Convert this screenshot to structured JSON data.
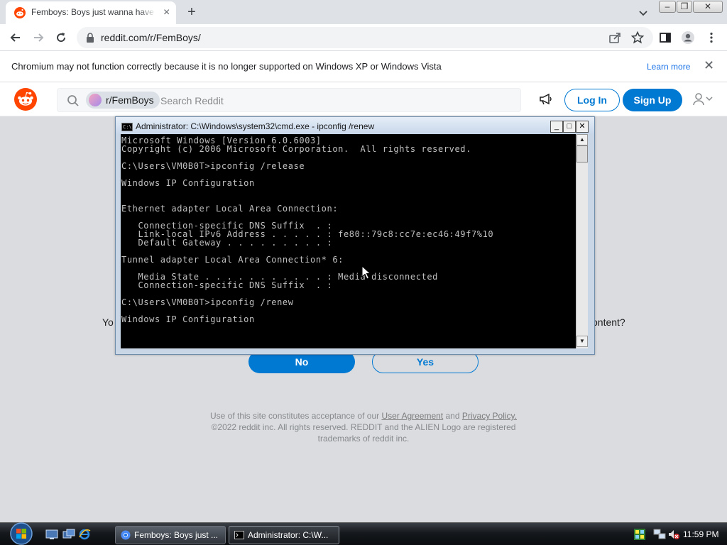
{
  "browser": {
    "tab_title": "Femboys: Boys just wanna have fun",
    "tab_close": "×",
    "new_tab": "+",
    "url": "reddit.com/r/FemBoys/",
    "window_buttons": {
      "minimize": "–",
      "restore": "❐",
      "close": "✕"
    }
  },
  "infobar": {
    "message": "Chromium may not function correctly because it is no longer supported on Windows XP or Windows Vista",
    "learn_more": "Learn more",
    "close": "✕"
  },
  "reddit": {
    "community_chip": "r/FemBoys",
    "search_placeholder": "Search Reddit",
    "login": "Log In",
    "signup": "Sign Up",
    "prompt_left": "Yo",
    "prompt_right": "ontent?",
    "no": "No",
    "yes": "Yes",
    "footer_pre": "Use of this site constitutes acceptance of our ",
    "footer_link1": "User Agreement",
    "footer_mid": " and ",
    "footer_link2": "Privacy Policy.",
    "footer_line2": "©2022 reddit inc. All rights reserved. REDDIT and the ALIEN Logo are registered",
    "footer_line3": "trademarks of reddit inc."
  },
  "cmd": {
    "title": "Administrator: C:\\Windows\\system32\\cmd.exe - ipconfig  /renew",
    "icon_label": "C:\\",
    "buttons": {
      "minimize": "_",
      "maximize": "□",
      "close": "✕"
    },
    "output": "Microsoft Windows [Version 6.0.6003]\nCopyright (c) 2006 Microsoft Corporation.  All rights reserved.\n\nC:\\Users\\VM0B0T>ipconfig /release\n\nWindows IP Configuration\n\n\nEthernet adapter Local Area Connection:\n\n   Connection-specific DNS Suffix  . :\n   Link-local IPv6 Address . . . . . : fe80::79c8:cc7e:ec46:49f7%10\n   Default Gateway . . . . . . . . . :\n\nTunnel adapter Local Area Connection* 6:\n\n   Media State . . . . . . . . . . . : Media disconnected\n   Connection-specific DNS Suffix  . :\n\nC:\\Users\\VM0B0T>ipconfig /renew\n\nWindows IP Configuration"
  },
  "taskbar": {
    "buttons": [
      {
        "label": "Femboys: Boys just ..."
      },
      {
        "label": "Administrator: C:\\W..."
      }
    ],
    "clock": "11:59 PM"
  },
  "colors": {
    "reddit_blue": "#0079d3",
    "reddit_orange": "#ff4500",
    "page_bg": "#dadce0",
    "cmd_bg": "#000000",
    "cmd_text": "#c0c0c0"
  }
}
